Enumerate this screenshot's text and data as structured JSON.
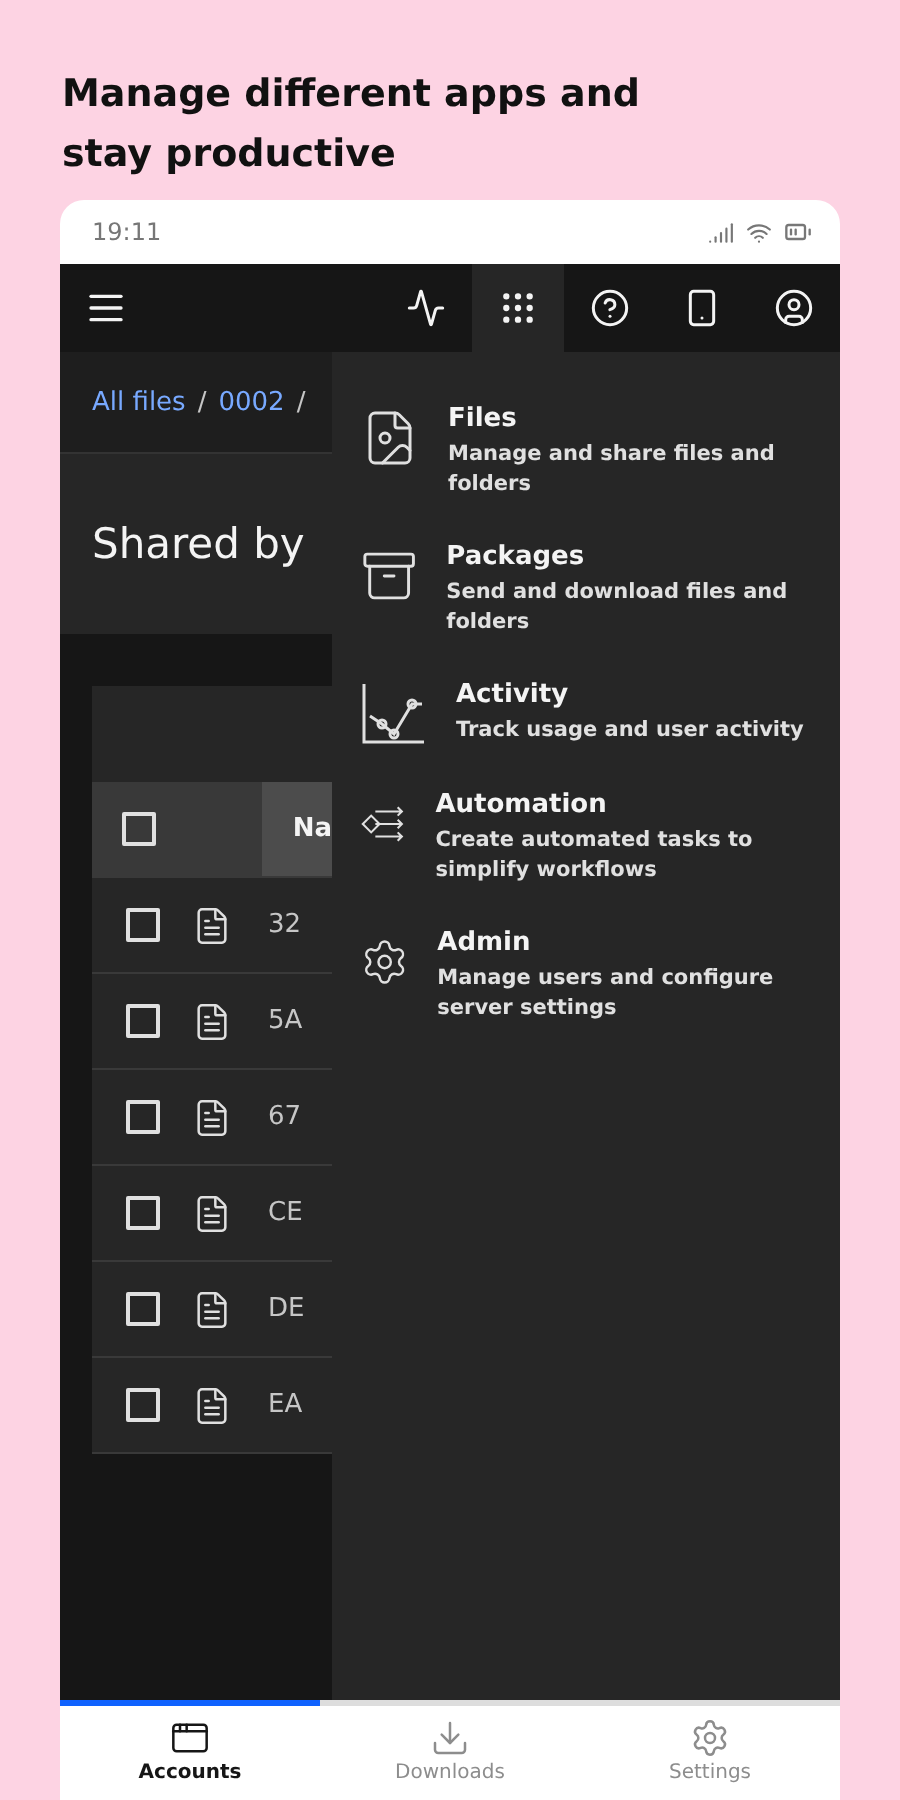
{
  "headline": "Manage different apps and stay productive",
  "status_bar": {
    "time": "19:11"
  },
  "header": {
    "buttons": [
      {
        "kind": "activity",
        "selected": false
      },
      {
        "kind": "apps",
        "selected": true
      },
      {
        "kind": "help",
        "selected": false
      },
      {
        "kind": "device",
        "selected": false
      },
      {
        "kind": "user",
        "selected": false
      }
    ]
  },
  "breadcrumb": [
    {
      "label": "All files",
      "separator": "/"
    },
    {
      "label": "0002",
      "separator": "/"
    }
  ],
  "page_title": "Shared by",
  "table": {
    "header_checked": false,
    "column_1": "Na",
    "rows": [
      {
        "name": "32",
        "checked": false
      },
      {
        "name": "5A",
        "checked": false
      },
      {
        "name": "67",
        "checked": false
      },
      {
        "name": "CE",
        "checked": false
      },
      {
        "name": "DE",
        "checked": false
      },
      {
        "name": "EA",
        "checked": false
      }
    ]
  },
  "app_menu": [
    {
      "kind": "files",
      "title": "Files",
      "description": "Manage and share files and folders"
    },
    {
      "kind": "packages",
      "title": "Packages",
      "description": "Send and download files and folders"
    },
    {
      "kind": "activity",
      "title": "Activity",
      "description": "Track usage and user activity"
    },
    {
      "kind": "automation",
      "title": "Automation",
      "description": "Create automated tasks to simplify workflows"
    },
    {
      "kind": "admin",
      "title": "Admin",
      "description": "Manage users and configure server settings"
    }
  ],
  "bottom_nav": [
    {
      "kind": "accounts",
      "label": "Accounts",
      "selected": true
    },
    {
      "kind": "downloads",
      "label": "Downloads",
      "selected": false
    },
    {
      "kind": "settings",
      "label": "Settings",
      "selected": false
    }
  ]
}
